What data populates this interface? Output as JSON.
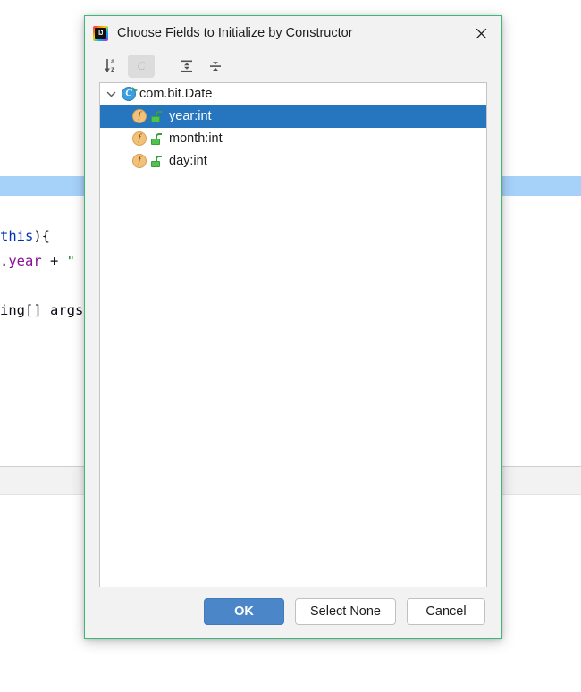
{
  "background_editor": {
    "code_lines": [
      {
        "tokens": [
          {
            "text": "this",
            "kind": "keyword"
          },
          {
            "text": "){",
            "kind": "punct"
          }
        ]
      },
      {
        "tokens": [
          {
            "text": ".",
            "kind": "punct"
          },
          {
            "text": "year",
            "kind": "field"
          },
          {
            "text": " + ",
            "kind": "plain"
          },
          {
            "text": "\"",
            "kind": "string"
          }
        ]
      },
      {
        "tokens": [
          {
            "text": "ing[] args",
            "kind": "plain"
          }
        ]
      }
    ],
    "highlight_color": "#a6d2fa",
    "band_color": "#f2f2f2"
  },
  "dialog": {
    "title": "Choose Fields to Initialize by Constructor",
    "app_icon_text": "IJ",
    "border_color": "#3cb878",
    "close_icon": "close-icon",
    "toolbar": {
      "items": [
        {
          "name": "sort-alphabetically-button",
          "icon": "sort-alphabetical-icon",
          "letters_top": "a",
          "letters_bottom": "z",
          "pressed": false
        },
        {
          "name": "show-class-button",
          "icon": "class-c-icon",
          "label": "C",
          "pressed": true
        },
        {
          "name": "expand-all-button",
          "icon": "expand-all-icon",
          "pressed": false
        },
        {
          "name": "collapse-all-button",
          "icon": "collapse-all-icon",
          "pressed": false
        }
      ]
    },
    "tree": {
      "root": {
        "label": "com.bit.Date",
        "icon": "class-icon",
        "expanded": true,
        "twisty": "chevron-down-icon",
        "class_letter": "C"
      },
      "fields": [
        {
          "label": "year:int",
          "icon": "field-icon",
          "letter": "f",
          "visibility_icon": "public-lock-icon",
          "selected": true
        },
        {
          "label": "month:int",
          "icon": "field-icon",
          "letter": "f",
          "visibility_icon": "public-lock-icon",
          "selected": false
        },
        {
          "label": "day:int",
          "icon": "field-icon",
          "letter": "f",
          "visibility_icon": "public-lock-icon",
          "selected": false
        }
      ],
      "selection_color": "#2675bf"
    },
    "buttons": {
      "ok": "OK",
      "select_none": "Select None",
      "cancel": "Cancel",
      "primary_color": "#4a86c8"
    }
  }
}
